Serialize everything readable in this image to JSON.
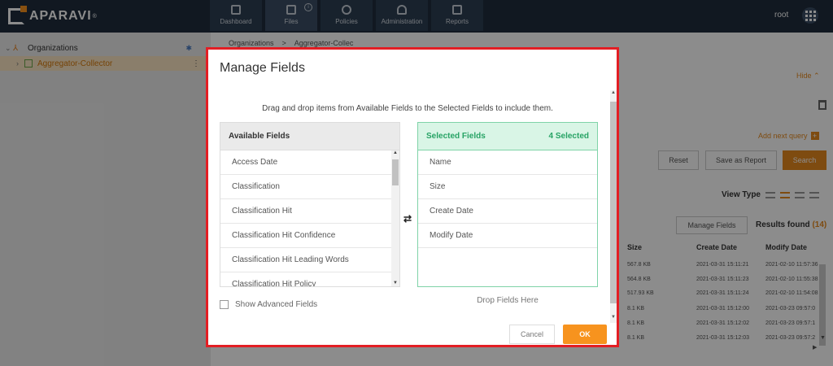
{
  "topbar": {
    "logo": "APARAVI",
    "nav": [
      {
        "label": "Dashboard",
        "icon": "dashboard-icon"
      },
      {
        "label": "Files",
        "icon": "folder-icon",
        "badge": "i"
      },
      {
        "label": "Policies",
        "icon": "gear-icon"
      },
      {
        "label": "Administration",
        "icon": "users-icon"
      },
      {
        "label": "Reports",
        "icon": "clipboard-icon"
      }
    ],
    "active_nav": "Files",
    "user": "root"
  },
  "sidebar": {
    "items": [
      {
        "label": "Organizations",
        "icon": "organization-icon"
      },
      {
        "label": "Aggregator-Collector",
        "icon": "aggregator-icon",
        "selected": true
      }
    ]
  },
  "background": {
    "breadcrumb": [
      "Organizations",
      ">",
      "Aggregator-Collec"
    ],
    "hide_label": "Hide",
    "add_next_query": "Add next query",
    "reset_label": "Reset",
    "save_report_label": "Save as Report",
    "search_label": "Search",
    "view_type_label": "View Type",
    "manage_fields_label": "Manage Fields",
    "results_label": "Results found",
    "results_count": "(14)",
    "columns": [
      "Size",
      "Create Date",
      "Modify Date"
    ],
    "rows": [
      [
        "567.8 KB",
        "2021-03-31 15:11:21",
        "2021-02-10 11:57:36"
      ],
      [
        "564.8 KB",
        "2021-03-31 15:11:23",
        "2021-02-10 11:55:38"
      ],
      [
        "517.93 KB",
        "2021-03-31 15:11:24",
        "2021-02-10 11:54:08"
      ],
      [
        "8.1 KB",
        "2021-03-31 15:12:00",
        "2021-03-23 09:57:0"
      ],
      [
        "8.1 KB",
        "2021-03-31 15:12:02",
        "2021-03-23 09:57:1"
      ],
      [
        "8.1 KB",
        "2021-03-31 15:12:03",
        "2021-03-23 09:57:2"
      ]
    ]
  },
  "modal": {
    "title": "Manage Fields",
    "instruction": "Drag and drop items from Available Fields to the Selected Fields to include them.",
    "available_header": "Available Fields",
    "available_fields": [
      "Access Date",
      "Classification",
      "Classification Hit",
      "Classification Hit Confidence",
      "Classification Hit Leading Words",
      "Classification Hit Policy"
    ],
    "selected_header": "Selected Fields",
    "selected_count": "4 Selected",
    "selected_fields": [
      "Name",
      "Size",
      "Create Date",
      "Modify Date"
    ],
    "drop_hint": "Drop Fields Here",
    "show_advanced_label": "Show Advanced Fields",
    "show_advanced_checked": false,
    "cancel_label": "Cancel",
    "ok_label": "OK"
  },
  "colors": {
    "accent": "#f7931e",
    "modal_border": "#e31e24",
    "selected_green": "#27a365",
    "topbar": "#1f2d3d"
  }
}
